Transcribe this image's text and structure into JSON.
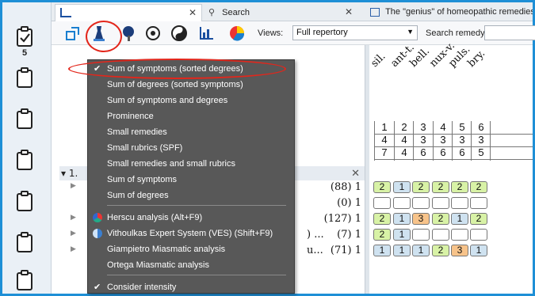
{
  "sidebar": {
    "items": [
      {
        "icon": "clipboard-check-icon",
        "number": "5"
      },
      {
        "icon": "clipboard-icon"
      },
      {
        "icon": "clipboard-icon"
      },
      {
        "icon": "clipboard-icon"
      },
      {
        "icon": "clipboard-icon"
      },
      {
        "icon": "clipboard-icon"
      },
      {
        "icon": "clipboard-icon"
      }
    ]
  },
  "tabs": [
    {
      "label": "",
      "icon": "repertory-chart-icon"
    },
    {
      "label": "Search",
      "icon": "search-icon"
    },
    {
      "label": "The \"genius\" of homeopathic remedies (GUNAVANTE S.M.)",
      "icon": "book-icon"
    }
  ],
  "toolbar": {
    "views_label": "Views:",
    "views_value": "Full repertory",
    "search_label": "Search remedy:",
    "search_value": ""
  },
  "menu": {
    "items": [
      {
        "label": "Sum of symptoms (sorted degrees)",
        "checked": true
      },
      {
        "label": "Sum of degrees (sorted symptoms)"
      },
      {
        "label": "Sum of symptoms and degrees"
      },
      {
        "label": "Prominence"
      },
      {
        "label": "Small remedies"
      },
      {
        "label": "Small rubrics (SPF)"
      },
      {
        "label": "Small remedies and small rubrics"
      },
      {
        "label": "Sum of symptoms"
      },
      {
        "label": "Sum of degrees"
      },
      {
        "label": "Herscu analysis (Alt+F9)",
        "icon": "herscu-icon"
      },
      {
        "label": "Vithoulkas Expert System (VES) (Shift+F9)",
        "icon": "ves-icon"
      },
      {
        "label": "Giampietro Miasmatic analysis"
      },
      {
        "label": "Ortega Miasmatic analysis"
      },
      {
        "label": "Consider intensity",
        "checked": true
      }
    ]
  },
  "analysis": {
    "remedies": [
      "sil.",
      "ant-t.",
      "bell.",
      "nux-v.",
      "puls.",
      "bry."
    ],
    "rank": [
      "1",
      "2",
      "3",
      "4",
      "5",
      "6"
    ],
    "symptoms": [
      "4",
      "4",
      "3",
      "3",
      "3",
      "3"
    ],
    "degrees": [
      "7",
      "4",
      "6",
      "6",
      "6",
      "5"
    ]
  },
  "rubrics": {
    "header_label": "1.",
    "rows": [
      {
        "fragment": "",
        "value": "(88) 1",
        "cells": [
          "2",
          "1",
          "2",
          "2",
          "2",
          "2"
        ]
      },
      {
        "fragment": "",
        "value": "(0) 1",
        "cells": [
          "",
          "",
          "",
          "",
          "",
          ""
        ]
      },
      {
        "fragment": "",
        "value": "(127) 1",
        "cells": [
          "2",
          "1",
          "3",
          "2",
          "1",
          "2"
        ]
      },
      {
        "fragment": ") ...",
        "value": "(7) 1",
        "cells": [
          "2",
          "1",
          "",
          "",
          "",
          ""
        ]
      },
      {
        "fragment": "u...",
        "value": "(71) 1",
        "cells": [
          "1",
          "1",
          "1",
          "2",
          "3",
          "1"
        ]
      }
    ]
  },
  "colors": {
    "frame": "#1e8fd6",
    "menu_bg": "#585858",
    "highlight": "#e3261b",
    "grade1": "#cfe2f0",
    "grade2": "#d8f2a6",
    "grade3": "#f7c38a"
  }
}
